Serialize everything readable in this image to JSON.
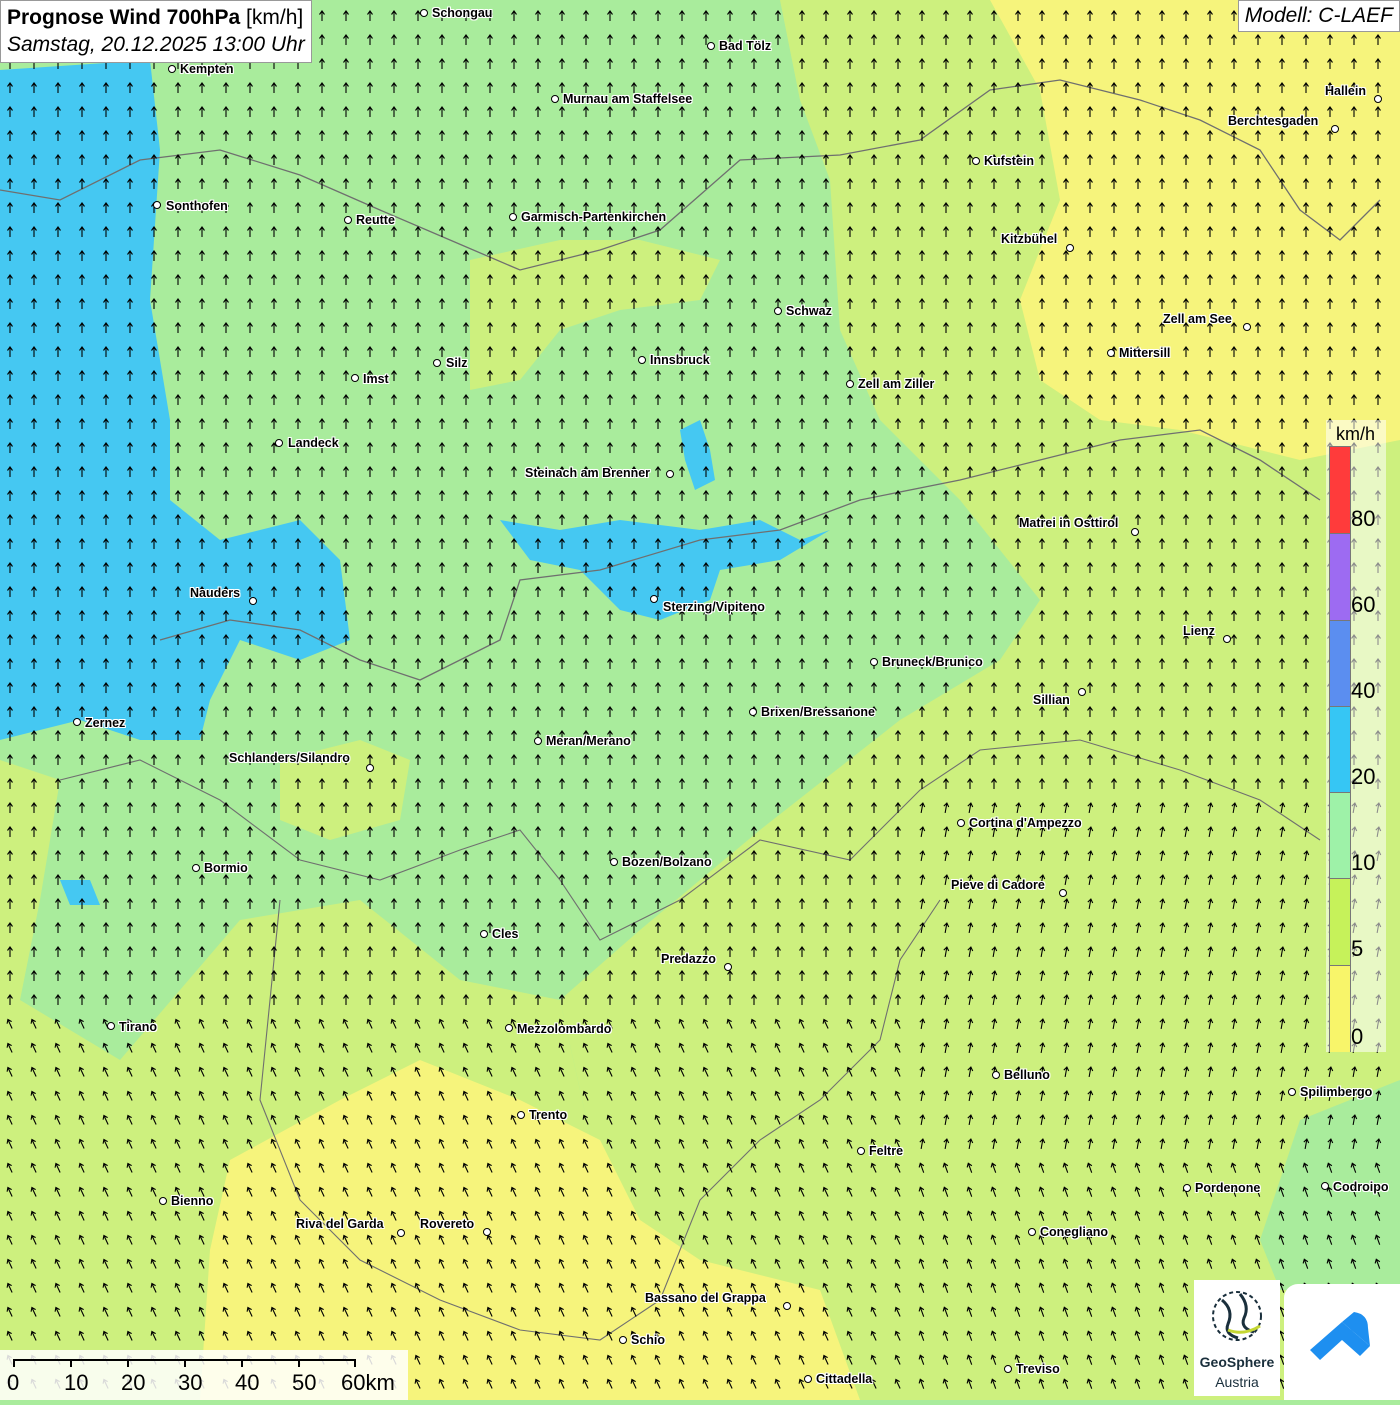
{
  "title": {
    "main_bold": "Prognose Wind 700hPa",
    "main_unit": "[km/h]",
    "date": "Samstag, 20.12.2025 13:00 Uhr"
  },
  "model": "Modell: C-LAEF",
  "legend": {
    "unit": "km/h",
    "ticks": [
      "80",
      "60",
      "40",
      "20",
      "10",
      "5",
      "0"
    ],
    "colors": [
      "#ff3b3b",
      "#9d6bf2",
      "#5b8ef0",
      "#36c6f4",
      "#9ef2a8",
      "#c6f25a",
      "#f8f56a"
    ]
  },
  "scale_bar": {
    "labels": [
      "0",
      "10",
      "20",
      "30",
      "40",
      "50",
      "60km"
    ]
  },
  "logos": {
    "geosphere_line1": "GeoSphere",
    "geosphere_line2": "Austria"
  },
  "cities": [
    {
      "name": "Schongau"
    },
    {
      "name": "Bad Tölz"
    },
    {
      "name": "Kempten"
    },
    {
      "name": "Murnau am Staffelsee"
    },
    {
      "name": "Hallein"
    },
    {
      "name": "Berchtesgaden"
    },
    {
      "name": "Kufstein"
    },
    {
      "name": "Sonthofen"
    },
    {
      "name": "Reutte"
    },
    {
      "name": "Garmisch-Partenkirchen"
    },
    {
      "name": "Kitzbühel"
    },
    {
      "name": "Schwaz"
    },
    {
      "name": "Zell am See"
    },
    {
      "name": "Mittersill"
    },
    {
      "name": "Imst"
    },
    {
      "name": "Silz"
    },
    {
      "name": "Innsbruck"
    },
    {
      "name": "Zell am Ziller"
    },
    {
      "name": "Landeck"
    },
    {
      "name": "Steinach am Brenner"
    },
    {
      "name": "Matrei in Osttirol"
    },
    {
      "name": "Nauders"
    },
    {
      "name": "Sterzing/Vipiteno"
    },
    {
      "name": "Lienz"
    },
    {
      "name": "Bruneck/Brunico"
    },
    {
      "name": "Sillian"
    },
    {
      "name": "Zernez"
    },
    {
      "name": "Brixen/Bressanone"
    },
    {
      "name": "Meran/Merano"
    },
    {
      "name": "Schlanders/Silandro"
    },
    {
      "name": "Cortina d'Ampezzo"
    },
    {
      "name": "Bormio"
    },
    {
      "name": "Bozen/Bolzano"
    },
    {
      "name": "Pieve di Cadore"
    },
    {
      "name": "Cles"
    },
    {
      "name": "Predazzo"
    },
    {
      "name": "Tirano"
    },
    {
      "name": "Mezzolombardo"
    },
    {
      "name": "Belluno"
    },
    {
      "name": "Spilimbergo"
    },
    {
      "name": "Trento"
    },
    {
      "name": "Feltre"
    },
    {
      "name": "Pordenone"
    },
    {
      "name": "Codroipo"
    },
    {
      "name": "Bienno"
    },
    {
      "name": "Riva del Garda"
    },
    {
      "name": "Rovereto"
    },
    {
      "name": "Conegliano"
    },
    {
      "name": "Bassano del Grappa"
    },
    {
      "name": "Schio"
    },
    {
      "name": "Treviso"
    },
    {
      "name": "Cittadella"
    }
  ]
}
